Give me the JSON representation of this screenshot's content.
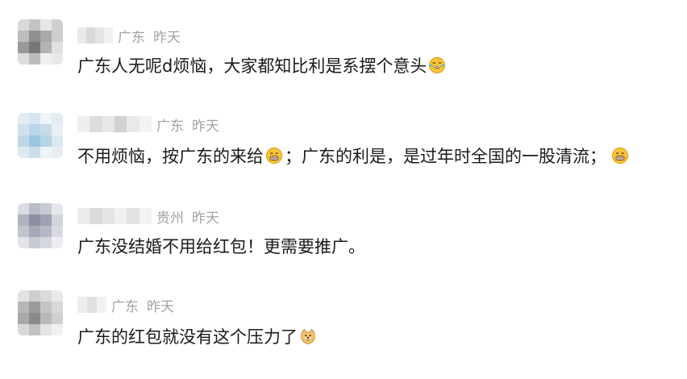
{
  "comments": [
    {
      "location": "广东",
      "time": "昨天",
      "text_before": "广东人无呢d烦恼，大家都知比利是系摆个意头",
      "emoji_1": "laughing-tears-icon",
      "text_after": "",
      "emoji_2": ""
    },
    {
      "location": "广东",
      "time": "昨天",
      "text_before": "不用烦恼，按广东的来给",
      "emoji_1": "grinning-icon",
      "text_after": "；广东的利是，是过年时全国的一股清流；",
      "emoji_2": "grinning-icon"
    },
    {
      "location": "贵州",
      "time": "昨天",
      "text_before": "广东没结婚不用给红包！更需要推广。",
      "emoji_1": "",
      "text_after": "",
      "emoji_2": ""
    },
    {
      "location": "广东",
      "time": "昨天",
      "text_before": "广东的红包就没有这个压力了",
      "emoji_1": "doge-icon",
      "text_after": "",
      "emoji_2": ""
    }
  ],
  "colors": {
    "meta_text": "#a3a3a3",
    "body_text": "#1a1a1a",
    "background": "#ffffff"
  }
}
